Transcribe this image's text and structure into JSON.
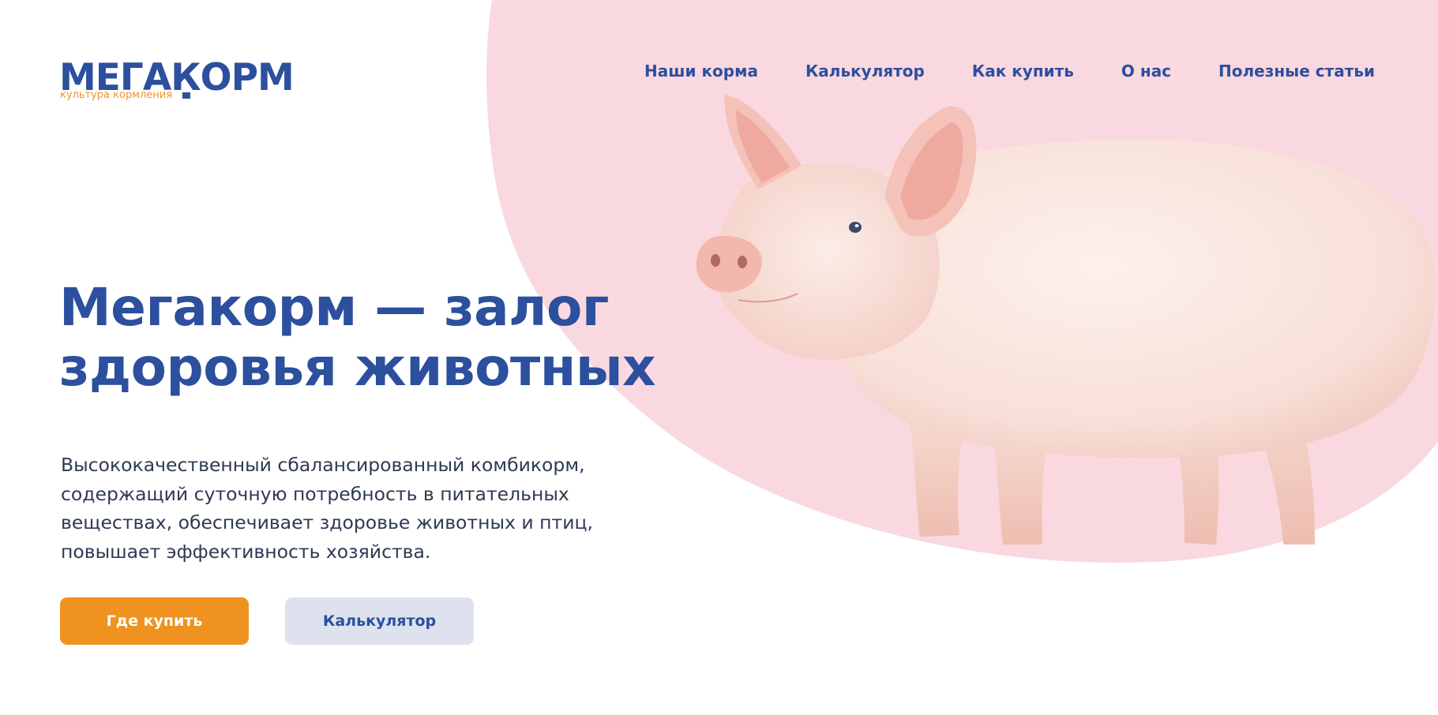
{
  "brand": {
    "logo_text": "МЕГАКОРМ",
    "tagline": "культура кормления",
    "color_primary": "#2c4f9e",
    "color_accent": "#f0921f",
    "color_hero_bg": "#f9d8df"
  },
  "nav": {
    "items": [
      {
        "label": "Наши корма"
      },
      {
        "label": "Калькулятор"
      },
      {
        "label": "Как купить"
      },
      {
        "label": "О нас"
      },
      {
        "label": "Полезные статьи"
      }
    ]
  },
  "hero": {
    "headline_line1": "Мегакорм — залог",
    "headline_line2": "здоровья животных",
    "description": "Высококачественный сбалансированный комбикорм, содержащий суточную потребность в питательных веществах, обеспечивает здоровье животных и птиц, повышает эффективность хозяйства.",
    "primary_button": "Где купить",
    "secondary_button": "Калькулятор",
    "image_icon": "pig-photo"
  }
}
